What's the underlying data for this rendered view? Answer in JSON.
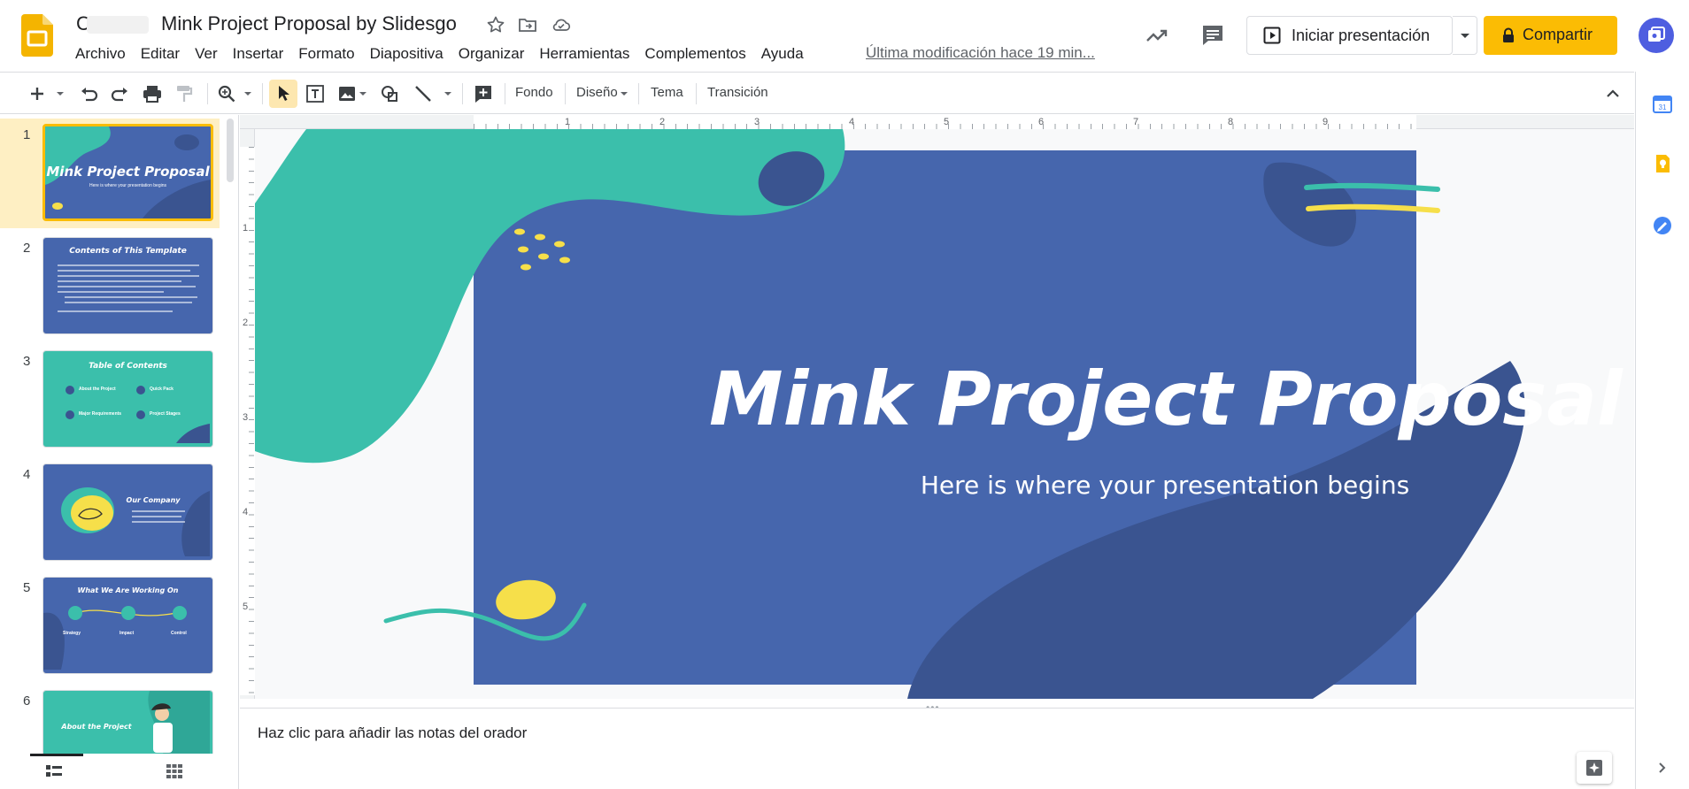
{
  "header": {
    "doc_title": "Mink Project Proposal by Slidesgo",
    "title_prefix_obscured": "C",
    "last_edit": "Última modificación hace 19 min...",
    "menu": [
      "Archivo",
      "Editar",
      "Ver",
      "Insertar",
      "Formato",
      "Diapositiva",
      "Organizar",
      "Herramientas",
      "Complementos",
      "Ayuda"
    ],
    "present_label": "Iniciar presentación",
    "share_label": "Compartir",
    "brand_color": "#fbbc04"
  },
  "toolbar": {
    "background_label": "Fondo",
    "layout_label": "Diseño",
    "theme_label": "Tema",
    "transition_label": "Transición"
  },
  "ruler": {
    "horizontal": [
      "1",
      "2",
      "3",
      "4",
      "5",
      "6",
      "7",
      "8",
      "9"
    ],
    "vertical": [
      "1",
      "2",
      "3",
      "4",
      "5"
    ]
  },
  "filmstrip": {
    "slides": [
      {
        "number": "1",
        "title": "Mink Project Proposal",
        "subtitle": "Here is where your presentation begins",
        "active": true
      },
      {
        "number": "2",
        "title": "Contents of This Template"
      },
      {
        "number": "3",
        "title": "Table of Contents",
        "items": [
          "About the Project",
          "Quick Pack",
          "Major Requirements",
          "Project Stages"
        ],
        "item_numbers": [
          "01",
          "03",
          "02",
          "04"
        ]
      },
      {
        "number": "4",
        "title": "Our Company"
      },
      {
        "number": "5",
        "title": "What We Are Working On",
        "items": [
          "Strategy",
          "Impact",
          "Control"
        ]
      },
      {
        "number": "6",
        "title": "About the Project"
      }
    ]
  },
  "slide": {
    "title": "Mink Project Proposal",
    "subtitle": "Here is where your presentation begins",
    "colors": {
      "blue": "#4666ad",
      "dark_blue": "#3a5490",
      "teal": "#3bbfab",
      "yellow": "#f6df4a"
    }
  },
  "notes": {
    "placeholder": "Haz clic para añadir las notas del orador"
  }
}
